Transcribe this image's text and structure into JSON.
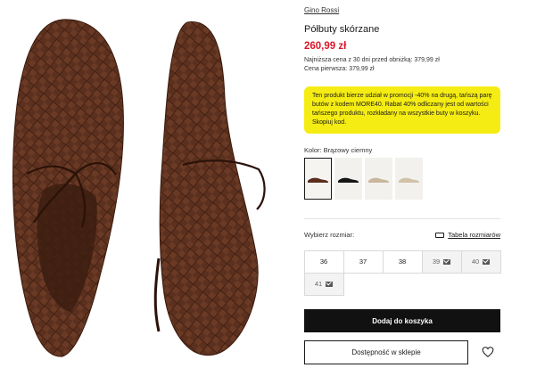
{
  "product": {
    "brand": "Gino Rossi",
    "title": "Półbuty skórzane",
    "price": "260,99 zł",
    "lowest_price_note": "Najniższa cena z 30 dni przed obniżką: 379,99 zł",
    "first_price_note": "Cena pierwsza: 379,99 zł"
  },
  "promo": {
    "text": "Ten produkt bierze udział w promocji -40% na drugą, tańszą parę butów z kodem MORE40. Rabat 40% odliczany jest od wartości tańszego produktu, rozkładany na wszystkie buty w koszyku. Skopiuj kod.",
    "background": "#f5ec14"
  },
  "color": {
    "label": "Kolor: Brązowy ciemny",
    "swatches": [
      {
        "name": "brown",
        "color": "#5a2e1c",
        "selected": true
      },
      {
        "name": "black",
        "color": "#151515",
        "selected": false
      },
      {
        "name": "beige",
        "color": "#c9b79c",
        "selected": false
      },
      {
        "name": "sand",
        "color": "#d2c3a8",
        "selected": false
      }
    ]
  },
  "size": {
    "label": "Wybierz rozmiar:",
    "table_link": "Tabela rozmiarów",
    "options": [
      {
        "value": "36",
        "available": true
      },
      {
        "value": "37",
        "available": true
      },
      {
        "value": "38",
        "available": true
      },
      {
        "value": "39",
        "available": false
      },
      {
        "value": "40",
        "available": false
      },
      {
        "value": "41",
        "available": false
      }
    ]
  },
  "actions": {
    "add_to_cart": "Dodaj do koszyka",
    "store_availability": "Dostępność w sklepie"
  },
  "colors": {
    "price": "#d7182a",
    "primary_button": "#111111",
    "shoe": "#5b301e"
  }
}
